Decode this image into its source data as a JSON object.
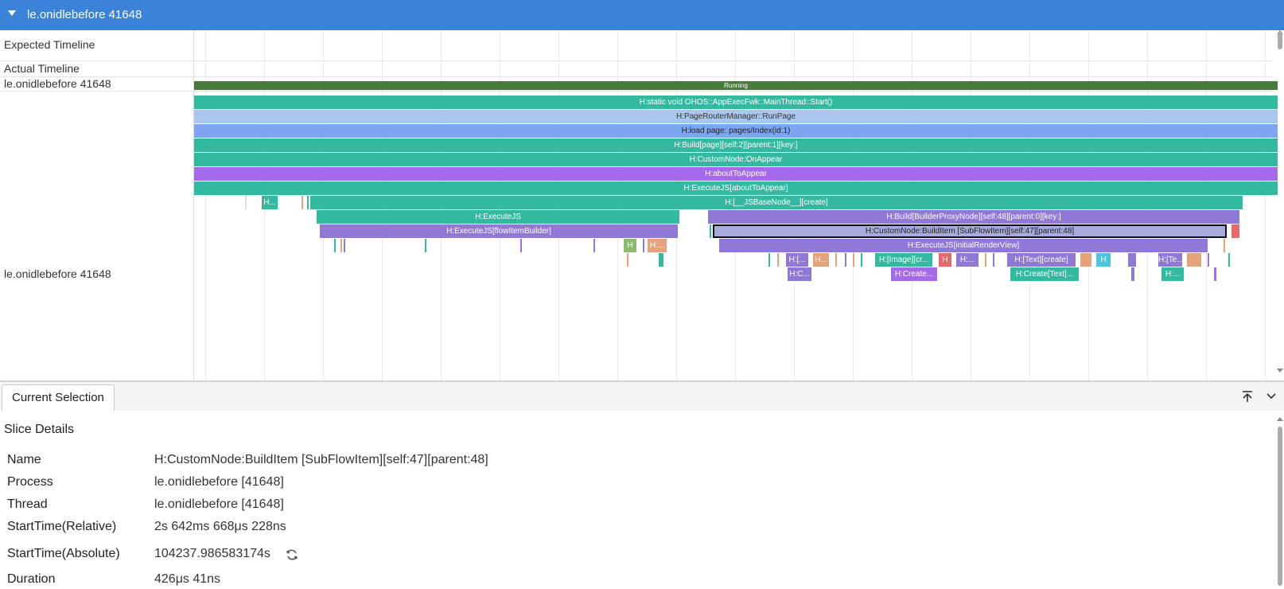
{
  "header": {
    "title": "le.onidlebefore 41648"
  },
  "rows": {
    "expected": "Expected Timeline",
    "actual": "Actual Timeline",
    "thread": "le.onidlebefore 41648",
    "process": "le.onidlebefore 41648"
  },
  "slices": {
    "running": "Running",
    "main_start": "H:static void OHOS::AppExecFwk::MainThread::Start()",
    "run_page": "H:PageRouterManager::RunPage",
    "load_page": "H:load page: pages/Index(id:1)",
    "build_page": "H:Build[page][self:2][parent:1][key:]",
    "custom_on_appear": "H:CustomNode:OnAppear",
    "about_to_appear": "H:aboutToAppear",
    "execute_about": "H:ExecuteJS[aboutToAppear]",
    "h_short": "H...",
    "js_base": "H:[__JSBaseNode__][create]",
    "execute_js": "H:ExecuteJS",
    "build_builder": "H:Build[BuilderProxyNode][self:48][parent:0][key:]",
    "execute_flow": "H:ExecuteJS[flowItemBuilder]",
    "build_item": "H:CustomNode:BuildItem [SubFlowItem][self:47][parent:48]",
    "h_small_1": "H",
    "h_small_2": "H:...",
    "initial_render": "H:ExecuteJS[initialRenderView]",
    "s_h1": "H:[...",
    "s_h2": "H...",
    "s_image": "H:[Image][cr...",
    "s_h3": "H",
    "s_h4": "H:...",
    "s_text": "H:[Text][create]",
    "s_h5": "H",
    "s_te": "H:[Te...",
    "s_c": "H:C...",
    "s_create": "H:Create...",
    "s_create_text": "H:Create[Text]...",
    "s_h6": "H:..."
  },
  "tab": {
    "label": "Current Selection"
  },
  "details": {
    "title": "Slice Details",
    "name_k": "Name",
    "name_v": "H:CustomNode:BuildItem [SubFlowItem][self:47][parent:48]",
    "process_k": "Process",
    "process_v": "le.onidlebefore [41648]",
    "thread_k": "Thread",
    "thread_v": "le.onidlebefore [41648]",
    "start_rel_k": "StartTime(Relative)",
    "start_rel_v": "2s 642ms 668μs 228ns",
    "start_abs_k": "StartTime(Absolute)",
    "start_abs_v": "104237.986583174s",
    "duration_k": "Duration",
    "duration_v": "426μs 41ns"
  },
  "colors": {
    "header": "#3b83d8",
    "teal": "#33b99f",
    "green": "#4a7a3a",
    "light_blue": "#a9c6ee",
    "blue": "#7ea5ef",
    "purple": "#a56ae8",
    "violet": "#8f78d6",
    "orange": "#e6a27a",
    "lavender": "#a8acdc",
    "salmon": "#e76a6a",
    "cyan": "#4cc6de",
    "lime": "#8cbc6e"
  },
  "icons": [
    "caret-down-icon",
    "pin-top-icon",
    "chevron-down-icon",
    "refresh-icon"
  ]
}
